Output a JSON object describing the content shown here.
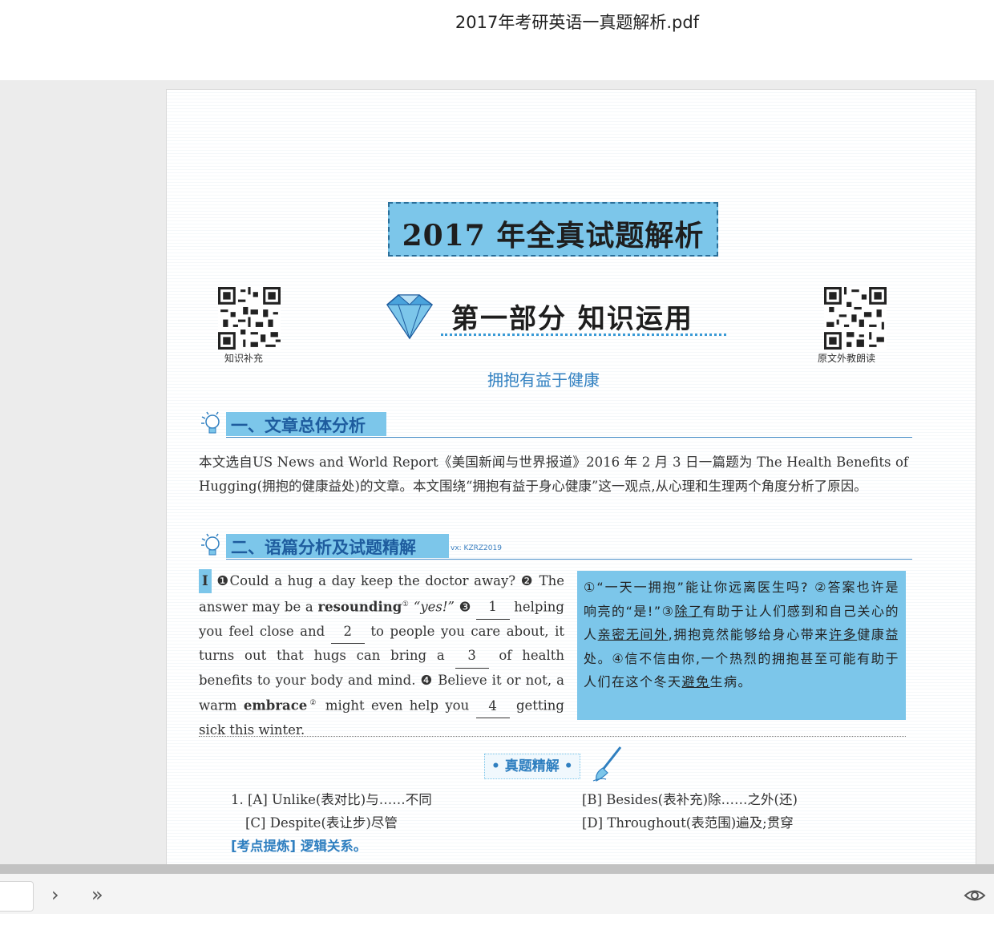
{
  "window": {
    "title": "2017年考研英语一真题解析.pdf"
  },
  "page": {
    "main_title": "2017 年全真试题解析",
    "qr_left_caption": "知识补充",
    "qr_right_caption": "原文外教朗读",
    "part_title": "第一部分  知识运用",
    "subtitle": "拥抱有益于健康",
    "section1_label": "一、文章总体分析",
    "section1_text": "本文选自US News and World Report《美国新闻与世界报道》2016 年 2 月 3 日一篇题为 The Health Benefits of Hugging(拥抱的健康益处)的文章。本文围绕“拥抱有益于身心健康”这一观点,从心理和生理两个角度分析了原因。",
    "section2_label": "二、语篇分析及试题精解",
    "watermark": "vx: KZRZ2019",
    "english": {
      "para_num": "Ⅰ",
      "s1": "❶Could a hug a day keep the doctor away? ❷ The answer may be a",
      "resounding": "resounding",
      "sup1": "①",
      "yes": "“yes!”",
      "s3a": "❸",
      "blank1": "1",
      "s3b": "helping you feel close and",
      "blank2": "2",
      "s3c": "to people you care about, it turns out that hugs can bring a",
      "blank3": "3",
      "s3d": "of health benefits to your body and mind. ❹ Believe it or not, a warm",
      "embrace": "embrace",
      "sup2": "②",
      "s4a": "might even help you",
      "blank4": "4",
      "s4b": "getting sick this winter."
    },
    "translation": {
      "t1": "①“一天一拥抱”能让你远离医生吗? ②答案也许是响亮的“是!”③",
      "u1": "除了",
      "t2": "有助于让人们感到和自己关心的人",
      "u2": "亲密无间外",
      "t3": ",拥抱竟然能够给身心带来",
      "u3": "许多",
      "t4": "健康益处。④信不信由你,一个热烈的拥抱甚至可能有助于人们在这个冬天",
      "u4": "避免",
      "t5": "生病。"
    },
    "zhenti_label": "• 真题精解 •",
    "options": {
      "a": "1. [A]  Unlike(表对比)与……不同",
      "b": "[B]  Besides(表补充)除……之外(还)",
      "c": "[C]  Despite(表让步)尽管",
      "d": "[D]  Throughout(表范围)遍及;贯穿"
    },
    "kaodian": "[考点提炼] 逻辑关系。"
  },
  "toolbar": {
    "next_label": "›",
    "last_label": "»"
  },
  "icons": {
    "next": "chevron-right-icon",
    "last": "double-chevron-right-icon",
    "view": "eye-icon",
    "diamond": "diamond-icon",
    "bulb": "lightbulb-icon",
    "brush": "brush-icon"
  },
  "colors": {
    "accent_blue": "#7cc6ea",
    "heading_blue": "#1e5c9e",
    "text_blue": "#2f7fc0"
  }
}
